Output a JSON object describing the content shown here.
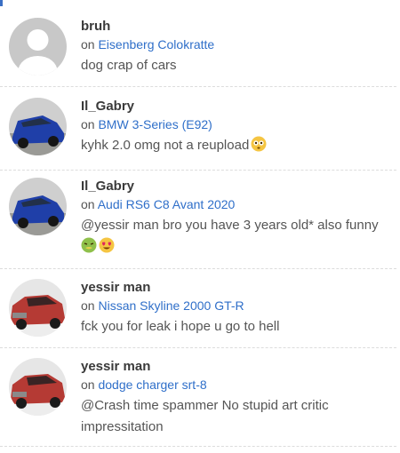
{
  "comments": [
    {
      "author": "bruh",
      "on_word": "on",
      "car": "Eisenberg Colokratte",
      "text": "dog crap of cars",
      "avatar": "default-avatar-icon"
    },
    {
      "author": "Il_Gabry",
      "on_word": "on",
      "car": "BMW 3-Series (E92)",
      "text": "kyhk 2.0 omg not a reupload",
      "emojis": [
        "flushed-face-icon"
      ],
      "avatar": "blue-wagon-avatar"
    },
    {
      "author": "Il_Gabry",
      "on_word": "on",
      "car": "Audi RS6 C8 Avant 2020",
      "text": "@yessir man bro you have 3 years old* also funny",
      "emojis": [
        "nauseated-face-icon",
        "heart-eyes-face-icon"
      ],
      "avatar": "blue-wagon-avatar"
    },
    {
      "author": "yessir man",
      "on_word": "on",
      "car": "Nissan Skyline 2000 GT-R",
      "text": "fck you for leak i hope u go to hell",
      "avatar": "red-suv-avatar"
    },
    {
      "author": "yessir man",
      "on_word": "on",
      "car": "dodge charger srt-8",
      "text": "@Crash time spammer No stupid art critic impressitation",
      "avatar": "red-suv-avatar"
    }
  ],
  "colors": {
    "link": "#2f6fc9",
    "accent": "#3a6fc4",
    "divider": "#dcdcdc"
  }
}
